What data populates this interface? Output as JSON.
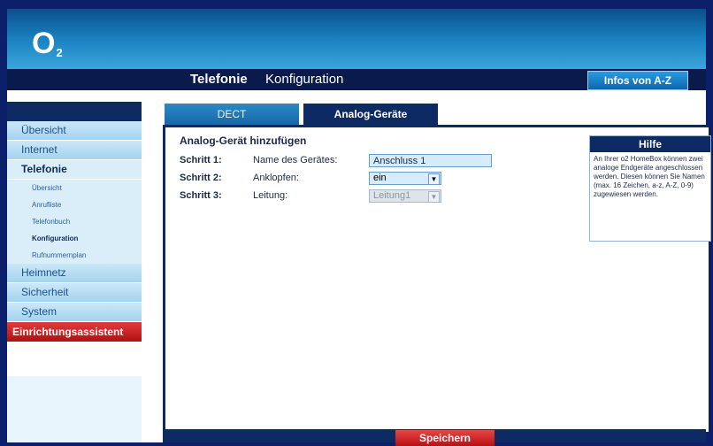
{
  "brand": {
    "logo": "O",
    "logo_sub": "2"
  },
  "title": {
    "section": "Telefonie",
    "page": "Konfiguration"
  },
  "infos_button": "Infos von A-Z",
  "sidebar": {
    "items": [
      {
        "label": "Übersicht"
      },
      {
        "label": "Internet"
      },
      {
        "label": "Telefonie"
      },
      {
        "label": "Heimnetz"
      },
      {
        "label": "Sicherheit"
      },
      {
        "label": "System"
      }
    ],
    "subitems": [
      {
        "label": "Übersicht"
      },
      {
        "label": "Anrufliste"
      },
      {
        "label": "Telefonbuch"
      },
      {
        "label": "Konfiguration"
      },
      {
        "label": "Rufnummernplan"
      }
    ],
    "assistant": "Einrichtungsassistent"
  },
  "tabs": [
    {
      "label": "DECT"
    },
    {
      "label": "Analog-Geräte"
    }
  ],
  "form": {
    "title": "Analog-Gerät hinzufügen",
    "steps": [
      {
        "step": "Schritt 1:",
        "label": "Name des Gerätes:",
        "value": "Anschluss 1"
      },
      {
        "step": "Schritt 2:",
        "label": "Anklopfen:",
        "value": "ein"
      },
      {
        "step": "Schritt 3:",
        "label": "Leitung:",
        "value": "Leitung1"
      }
    ]
  },
  "help": {
    "title": "Hilfe",
    "text": "An Ihrer o2 HomeBox können zwei analoge Endgeräte angeschlossen werden. Diesen können Sie Namen (max. 16 Zeichen, a-z, A-Z, 0-9) zugewiesen werden."
  },
  "save_button": "Speichern",
  "icons": {
    "dropdown": "chevron-down-icon"
  }
}
